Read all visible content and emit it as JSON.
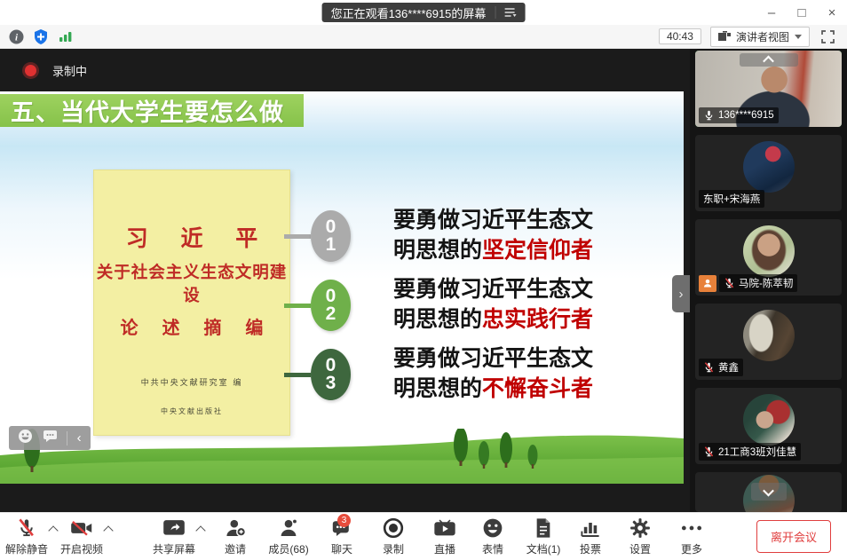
{
  "titlebar": {
    "title": "您正在观看136****6915的屏幕"
  },
  "statusbar": {
    "timer": "40:43",
    "view_mode": "演讲者视图"
  },
  "share": {
    "recording_label": "录制中",
    "slide": {
      "title": "五、当代大学生要怎么做",
      "highlight_color": "#c00000",
      "book": {
        "title_line1": "习 近 平",
        "title_line2": "关于社会主义生态文明建设",
        "title_line3": "论 述 摘 编",
        "editor": "中共中央文献研究室  编",
        "publisher": "中央文献出版社"
      },
      "points": [
        {
          "digit_top": "0",
          "digit_bottom": "1",
          "line1": "要勇做习近平生态文",
          "line2_prefix": "明思想的",
          "line2_highlight": "坚定信仰者",
          "circle_color": "#ababab"
        },
        {
          "digit_top": "0",
          "digit_bottom": "2",
          "line1": "要勇做习近平生态文",
          "line2_prefix": "明思想的",
          "line2_highlight": "忠实践行者",
          "circle_color": "#6fb04a"
        },
        {
          "digit_top": "0",
          "digit_bottom": "3",
          "line1": "要勇做习近平生态文",
          "line2_prefix": "明思想的",
          "line2_highlight": "不懈奋斗者",
          "circle_color": "#3e673e"
        }
      ]
    }
  },
  "participants": [
    {
      "name": "136****6915"
    },
    {
      "name": "东职+宋海燕"
    },
    {
      "name": "马院-陈萃韧"
    },
    {
      "name": "黄鑫"
    },
    {
      "name": "21工商3班刘佳慧"
    }
  ],
  "toolbar": {
    "mute": "解除静音",
    "video": "开启视频",
    "share_screen": "共享屏幕",
    "invite": "邀请",
    "members": "成员(68)",
    "chat": "聊天",
    "chat_badge": "3",
    "record": "录制",
    "live": "直播",
    "emoji": "表情",
    "docs": "文档(1)",
    "vote": "投票",
    "settings": "设置",
    "more": "更多",
    "leave": "离开会议"
  },
  "icons": {
    "minimize": "–",
    "maximize": "□",
    "close": "×",
    "collapse_left": "‹",
    "expand_right": "›"
  }
}
